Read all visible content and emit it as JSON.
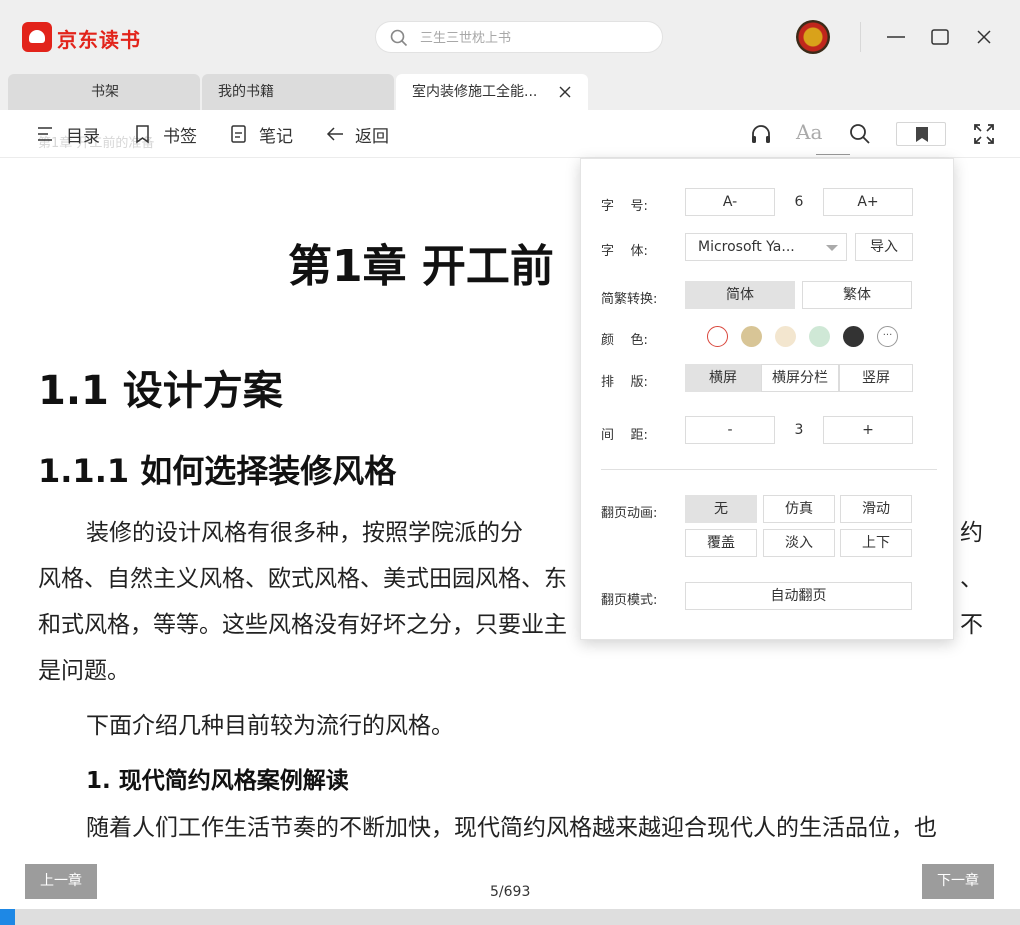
{
  "app": {
    "name": "京东读书"
  },
  "search": {
    "placeholder": "三生三世枕上书"
  },
  "tabs": [
    {
      "label": "书架"
    },
    {
      "label": "我的书籍"
    },
    {
      "label": "室内装修施工全能..."
    }
  ],
  "toolbar": {
    "toc_label": "目录",
    "bookmarks_label": "书签",
    "notes_label": "笔记",
    "back_label": "返回",
    "font_icon_text": "Aa",
    "ghost_title": "第1章 开工前的准备"
  },
  "content": {
    "chapter_title": "第1章 开工前",
    "section_title": "1.1 设计方案",
    "subsection_title": "1.1.1 如何选择装修风格",
    "para1_line1": "装修的设计风格有很多种，按照学院派的分",
    "para1_line1_tail": "约",
    "para1_line2": "风格、自然主义风格、欧式风格、美式田园风格、东",
    "para1_line2_tail": "、",
    "para1_line3": "和式风格，等等。这些风格没有好坏之分，只要业主",
    "para1_line3_tail": "不",
    "para1_line4": "是问题。",
    "para2": "下面介绍几种目前较为流行的风格。",
    "h4": "1. 现代简约风格案例解读",
    "para3": "随着人们工作生活节奏的不断加快，现代简约风格越来越迎合现代人的生活品位，也"
  },
  "footer": {
    "prev_label": "上一章",
    "next_label": "下一章",
    "page_indicator": "5/693",
    "progress": 0.0072
  },
  "settings": {
    "font_size_label": "字    号:",
    "font_size_decrease": "A-",
    "font_size_value": "6",
    "font_size_increase": "A+",
    "font_label": "字    体:",
    "font_value": "Microsoft Ya...",
    "import_label": "导入",
    "convert_label": "简繁转换:",
    "simplified": "简体",
    "traditional": "繁体",
    "color_label": "颜    色:",
    "colors": [
      "#ffffff",
      "#d8c596",
      "#f3e6cf",
      "#cfe8d6",
      "#333333"
    ],
    "color_more": "···",
    "layout_label": "排    版:",
    "layout_options": [
      "横屏",
      "横屏分栏",
      "竖屏"
    ],
    "spacing_label": "间    距:",
    "spacing_decrease": "-",
    "spacing_value": "3",
    "spacing_increase": "+",
    "animation_label": "翻页动画:",
    "animation_options": [
      "无",
      "仿真",
      "滑动",
      "覆盖",
      "淡入",
      "上下"
    ],
    "mode_label": "翻页模式:",
    "mode_value": "自动翻页"
  }
}
